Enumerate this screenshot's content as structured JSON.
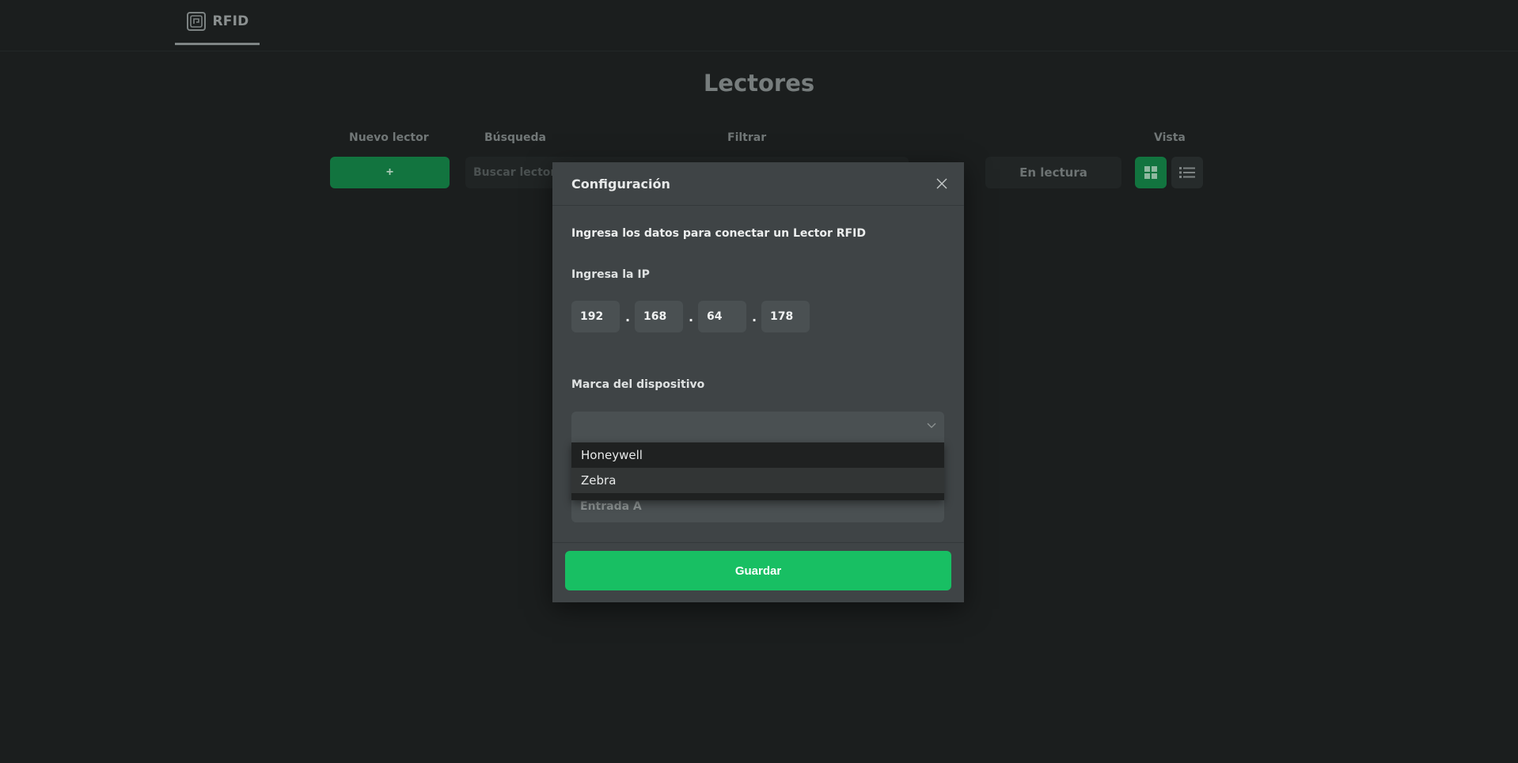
{
  "header": {
    "brand_label": "RFID",
    "brand_icon": "rfid-chip-icon"
  },
  "page": {
    "title": "Lectores"
  },
  "toolbar": {
    "new_reader_label": "Nuevo lector",
    "new_reader_button": "+",
    "search_label": "Búsqueda",
    "search_placeholder": "Buscar lector",
    "filter_label": "Filtrar",
    "filter_option_reading": "En lectura",
    "view_label": "Vista",
    "view_grid_icon": "grid-icon",
    "view_list_icon": "list-icon"
  },
  "modal": {
    "title": "Configuración",
    "intro": "Ingresa los datos para conectar un Lector RFID",
    "ip_label": "Ingresa la IP",
    "ip_parts": [
      "192",
      "168",
      "64",
      "178"
    ],
    "brand_label": "Marca del dispositivo",
    "brand_options": [
      "Honeywell",
      "Zebra"
    ],
    "name_value": "Entrada A",
    "save_label": "Guardar"
  },
  "colors": {
    "accent": "#18bf63",
    "accent_dim": "#12743f",
    "background": "#1b1e1e",
    "modal_bg": "#3f4446"
  }
}
